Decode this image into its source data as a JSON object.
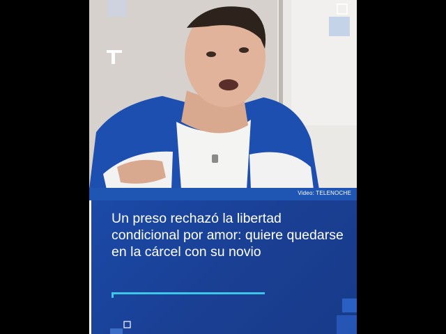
{
  "video": {
    "credit": "Video: TELENOCHE",
    "headline": "Un preso rechazó la libertad condicional por amor: quiere quedarse en la cárcel con su novio"
  },
  "brand": {
    "logo_icon": "telefe-t-logo-icon"
  },
  "colors": {
    "page_background": "#000000",
    "panel_blue": "#1b4aa8",
    "credit_bar_blue": "#1f55b3",
    "accent_cyan": "#3ec6e8",
    "text_white": "#ffffff"
  }
}
